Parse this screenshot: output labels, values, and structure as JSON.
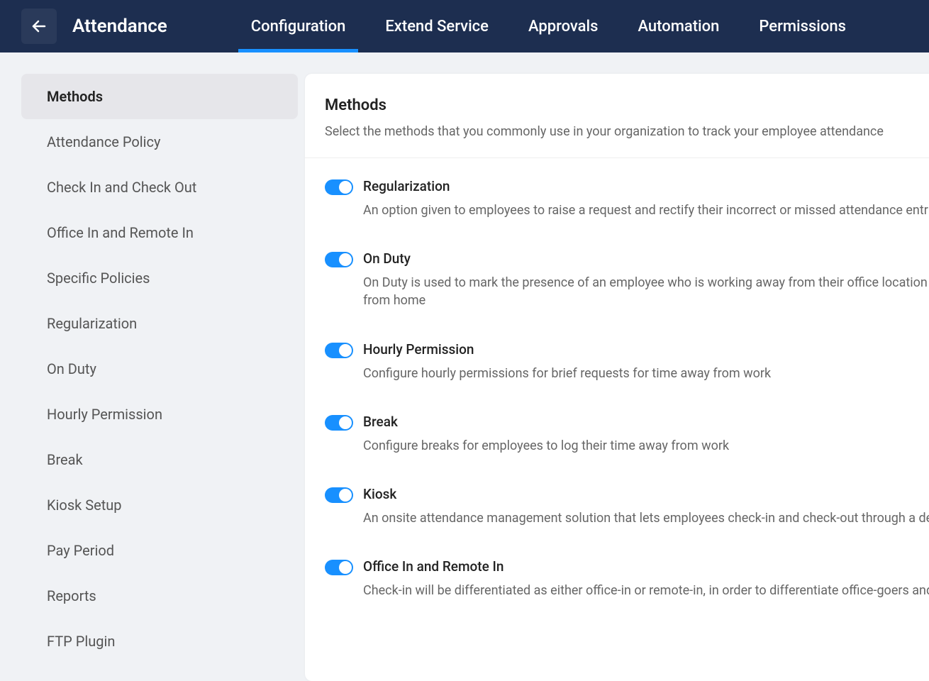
{
  "header": {
    "title": "Attendance",
    "tabs": [
      {
        "label": "Configuration",
        "active": true
      },
      {
        "label": "Extend Service",
        "active": false
      },
      {
        "label": "Approvals",
        "active": false
      },
      {
        "label": "Automation",
        "active": false
      },
      {
        "label": "Permissions",
        "active": false
      }
    ]
  },
  "sidebar": {
    "items": [
      {
        "label": "Methods",
        "active": true
      },
      {
        "label": "Attendance Policy",
        "active": false
      },
      {
        "label": "Check In and Check Out",
        "active": false
      },
      {
        "label": "Office In and Remote In",
        "active": false
      },
      {
        "label": "Specific Policies",
        "active": false
      },
      {
        "label": "Regularization",
        "active": false
      },
      {
        "label": "On Duty",
        "active": false
      },
      {
        "label": "Hourly Permission",
        "active": false
      },
      {
        "label": "Break",
        "active": false
      },
      {
        "label": "Kiosk Setup",
        "active": false
      },
      {
        "label": "Pay Period",
        "active": false
      },
      {
        "label": "Reports",
        "active": false
      },
      {
        "label": "FTP Plugin",
        "active": false
      }
    ]
  },
  "content": {
    "title": "Methods",
    "subtitle": "Select the methods that you commonly use in your organization to track your employee attendance",
    "methods": [
      {
        "title": "Regularization",
        "desc": "An option given to employees to raise a request and rectify their incorrect or missed attendance entries",
        "on": true
      },
      {
        "title": "On Duty",
        "desc": "On Duty is used to mark the presence of an employee who is working away from their office location or working",
        "desc2": "from home",
        "on": true
      },
      {
        "title": "Hourly Permission",
        "desc": "Configure hourly permissions for brief requests for time away from work",
        "on": true
      },
      {
        "title": "Break",
        "desc": "Configure breaks for employees to log their time away from work",
        "on": true
      },
      {
        "title": "Kiosk",
        "desc": "An onsite attendance management solution that lets employees check-in and check-out through a device",
        "on": true
      },
      {
        "title": "Office In and Remote In",
        "desc": "Check-in will be differentiated as either office-in or remote-in, in order to differentiate office-goers and remote workers",
        "on": true
      }
    ]
  }
}
